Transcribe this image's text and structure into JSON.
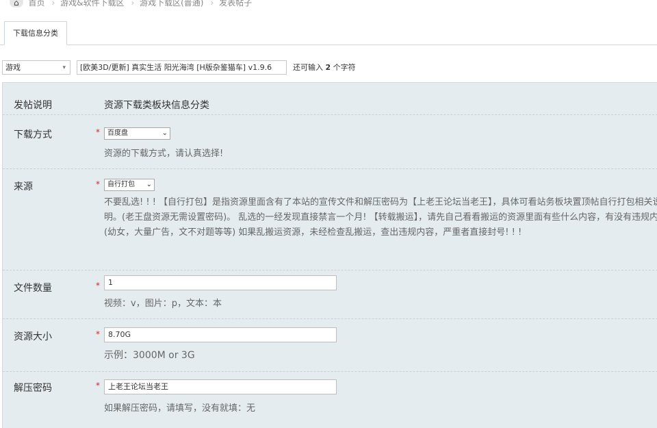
{
  "breadcrumb": {
    "items": [
      "首页",
      "游戏&软件下载区",
      "游戏下载区(普通)",
      "发表帖子"
    ],
    "home_icon": "home-icon"
  },
  "tabs": [
    {
      "label": "下载信息分类"
    }
  ],
  "post_type": {
    "selected": "游戏"
  },
  "title_input": {
    "value": "[欧美3D/更新] 真实生活 阳光海湾 [H版杂鉴猫车] v1.9.6"
  },
  "remaining": {
    "prefix": "还可输入",
    "count": "2",
    "suffix": "个字符"
  },
  "form": {
    "intro": {
      "label": "发帖说明",
      "value": "资源下载类板块信息分类"
    },
    "download_method": {
      "label": "下载方式",
      "selected": "百度盘",
      "help": "资源的下载方式，请认真选择!"
    },
    "source": {
      "label": "来源",
      "selected": "自行打包",
      "help": "不要乱选! ! ! 【自行打包】是指资源里面含有了本站的宣传文件和解压密码为【上老王论坛当老王】，具体可看站务板块置顶帖自行打包相关说明。(老王盘资源无需设置密码)。 乱选的一经发现直接禁言一个月! 【转载搬运】，请先自己看看搬运的资源里面有些什么内容，有没有违规内容 (幼女，大量广告，文不对题等等) 如果乱搬运资源，未经检查乱搬运，查出违规内容，严重者直接封号! ! !"
    },
    "file_count": {
      "label": "文件数量",
      "value": "1",
      "help": "视频：v，图片：p，文本：本"
    },
    "size": {
      "label": "资源大小",
      "value": "8.70G",
      "help": "示例：3000M or 3G"
    },
    "password": {
      "label": "解压密码",
      "value": "上老王论坛当老王",
      "help": "如果解压密码，请填写，没有就填：无"
    }
  },
  "required_mark": "*"
}
